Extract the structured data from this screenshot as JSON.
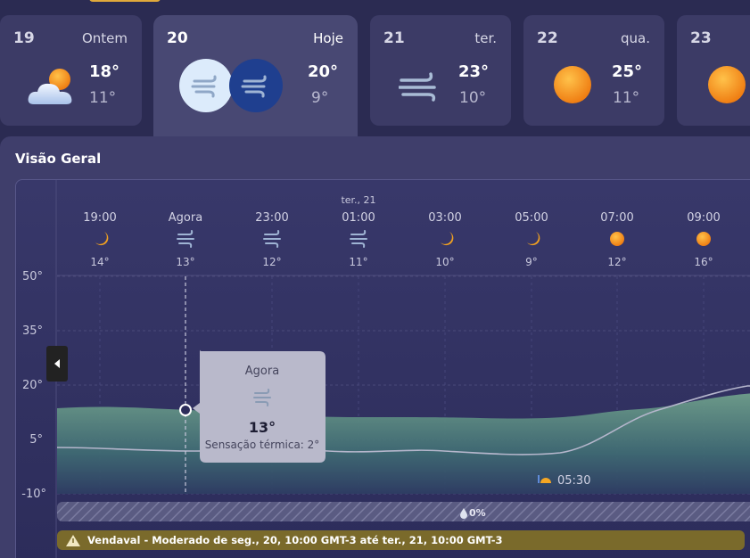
{
  "days": [
    {
      "num": "19",
      "name": "Ontem",
      "high": "18°",
      "low": "11°",
      "icon": "partly-cloudy-icon"
    },
    {
      "num": "20",
      "name": "Hoje",
      "high": "20°",
      "low": "9°",
      "icon": "wind-icon"
    },
    {
      "num": "21",
      "name": "ter.",
      "high": "23°",
      "low": "10°",
      "icon": "wind-icon"
    },
    {
      "num": "22",
      "name": "qua.",
      "high": "25°",
      "low": "11°",
      "icon": "sun-icon"
    },
    {
      "num": "23",
      "name": "",
      "high": "",
      "low": "",
      "icon": "sun-icon"
    }
  ],
  "overview": {
    "title": "Visão Geral",
    "date_marker": "ter., 21",
    "hours": [
      {
        "time": "19:00",
        "icon": "moon-icon",
        "temp": "14°"
      },
      {
        "time": "Agora",
        "icon": "wind-icon",
        "temp": "13°"
      },
      {
        "time": "23:00",
        "icon": "wind-icon",
        "temp": "12°"
      },
      {
        "time": "01:00",
        "icon": "wind-icon",
        "temp": "11°"
      },
      {
        "time": "03:00",
        "icon": "moon-icon",
        "temp": "10°"
      },
      {
        "time": "05:00",
        "icon": "moon-icon",
        "temp": "9°"
      },
      {
        "time": "07:00",
        "icon": "sun-icon",
        "temp": "12°"
      },
      {
        "time": "09:00",
        "icon": "sun-icon",
        "temp": "16°"
      }
    ],
    "y_ticks": [
      "50°",
      "35°",
      "20°",
      "5°",
      "-10°"
    ],
    "tooltip": {
      "title": "Agora",
      "temp": "13°",
      "feels": "Sensação térmica: 2°"
    },
    "sunrise": "05:30",
    "precip": "0%",
    "alert": "Vendaval - Moderado de seg., 20, 10:00 GMT-3 até ter., 21, 10:00 GMT-3"
  },
  "colors": {
    "accent_blue": "#1f3f8f",
    "alert_bg": "#7a6a2b",
    "area_fill": "#6e9e8a",
    "sun": "#f08c1a"
  }
}
